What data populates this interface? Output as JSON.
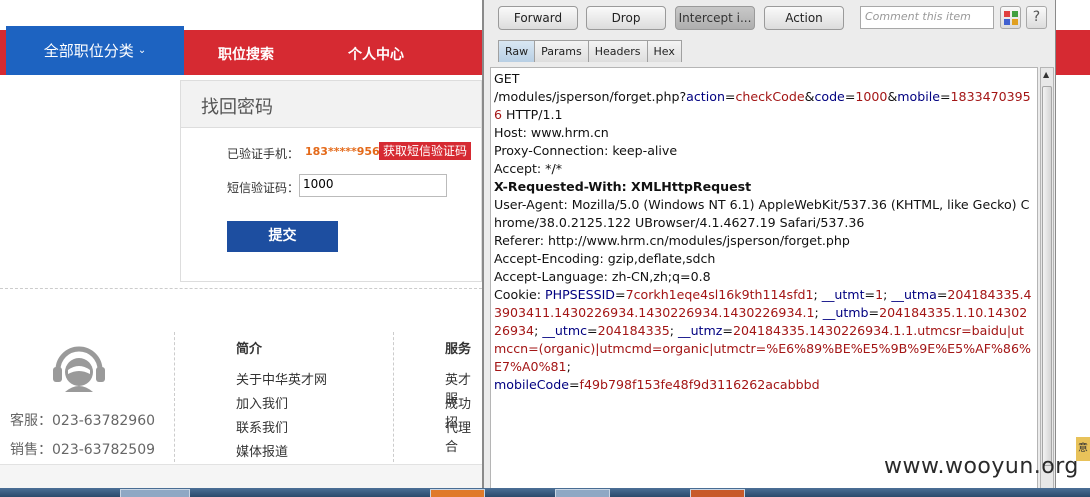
{
  "site": {
    "nav": {
      "category_menu": "全部职位分类",
      "job_search": "职位搜索",
      "personal_center": "个人中心"
    },
    "recover": {
      "title": "找回密码",
      "phone_label": "已验证手机：",
      "phone_value": "183*****956",
      "sms_button": "获取短信验证码",
      "code_label": "短信验证码：",
      "code_value": "1000",
      "submit": "提交"
    },
    "footer": {
      "service_phone": "客服：023-63782960",
      "sales_phone": "销售：023-63782509",
      "col1_title": "简介",
      "col1_items": [
        "关于中华英才网",
        "加入我们",
        "联系我们",
        "媒体报道"
      ],
      "col2_title": "服务",
      "col2_items": [
        "英才服",
        "成功招",
        "代理合"
      ]
    }
  },
  "burp": {
    "buttons": {
      "forward": "Forward",
      "drop": "Drop",
      "intercept": "Intercept i...",
      "action": "Action"
    },
    "comment_placeholder": "Comment this item",
    "help": "?",
    "tabs": [
      "Raw",
      "Params",
      "Headers",
      "Hex"
    ],
    "request": {
      "method": "GET",
      "path": "/modules/jsperson/forget.php",
      "params": [
        {
          "name": "action",
          "value": "checkCode"
        },
        {
          "name": "code",
          "value": "1000"
        },
        {
          "name": "mobile",
          "value": "18334703956"
        }
      ],
      "protocol": "HTTP/1.1",
      "headers": [
        "Host: www.hrm.cn",
        "Proxy-Connection: keep-alive",
        "Accept: */*",
        "X-Requested-With: XMLHttpRequest",
        "User-Agent: Mozilla/5.0 (Windows NT 6.1) AppleWebKit/537.36 (KHTML, like Gecko) Chrome/38.0.2125.122 UBrowser/4.1.4627.19 Safari/537.36",
        "Referer: http://www.hrm.cn/modules/jsperson/forget.php",
        "Accept-Encoding: gzip,deflate,sdch",
        "Accept-Language: zh-CN,zh;q=0.8"
      ],
      "cookies": [
        {
          "name": "PHPSESSID",
          "value": "7corkh1eqe4sl16k9th114sfd1"
        },
        {
          "name": "__utmt",
          "value": "1"
        },
        {
          "name": "__utma",
          "value": "204184335.43903411.1430226934.1430226934.1430226934.1"
        },
        {
          "name": "__utmb",
          "value": "204184335.1.10.1430226934"
        },
        {
          "name": "__utmc",
          "value": "204184335"
        },
        {
          "name": "__utmz",
          "value": "204184335.1430226934.1.1.utmcsr=baidu|utmccn=(organic)|utmcmd=organic|utmctr=%E6%89%BE%E5%9B%9E%E5%AF%86%E7%A0%81"
        }
      ],
      "body_param": {
        "name": "mobileCode",
        "value": "f49b798f153fe48f9d3116262acabbbd"
      }
    }
  },
  "side_tag": "意",
  "watermark": "www.wooyun.org"
}
